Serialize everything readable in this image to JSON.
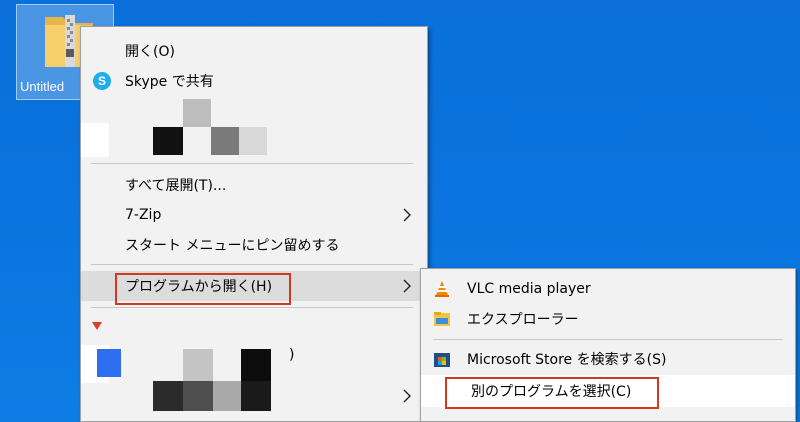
{
  "desktop": {
    "icon_label": "Untitled"
  },
  "context_menu": {
    "items": [
      {
        "label": "開く(O)"
      },
      {
        "label": "Skype で共有"
      },
      {
        "label": "すべて展開(T)..."
      },
      {
        "label": "7-Zip"
      },
      {
        "label": "スタート メニューにピン留めする"
      },
      {
        "label": "プログラムから開く(H)"
      }
    ],
    "partial_text": ")"
  },
  "submenu": {
    "items": [
      {
        "label": "VLC media player"
      },
      {
        "label": "エクスプローラー"
      },
      {
        "label": "Microsoft Store を検索する(S)"
      },
      {
        "label": "別のプログラムを選択(C)"
      }
    ]
  },
  "colors": {
    "desktop_bg": "#0b74de",
    "menu_bg": "#f2f2f2",
    "highlight_box": "#d23a1f"
  }
}
